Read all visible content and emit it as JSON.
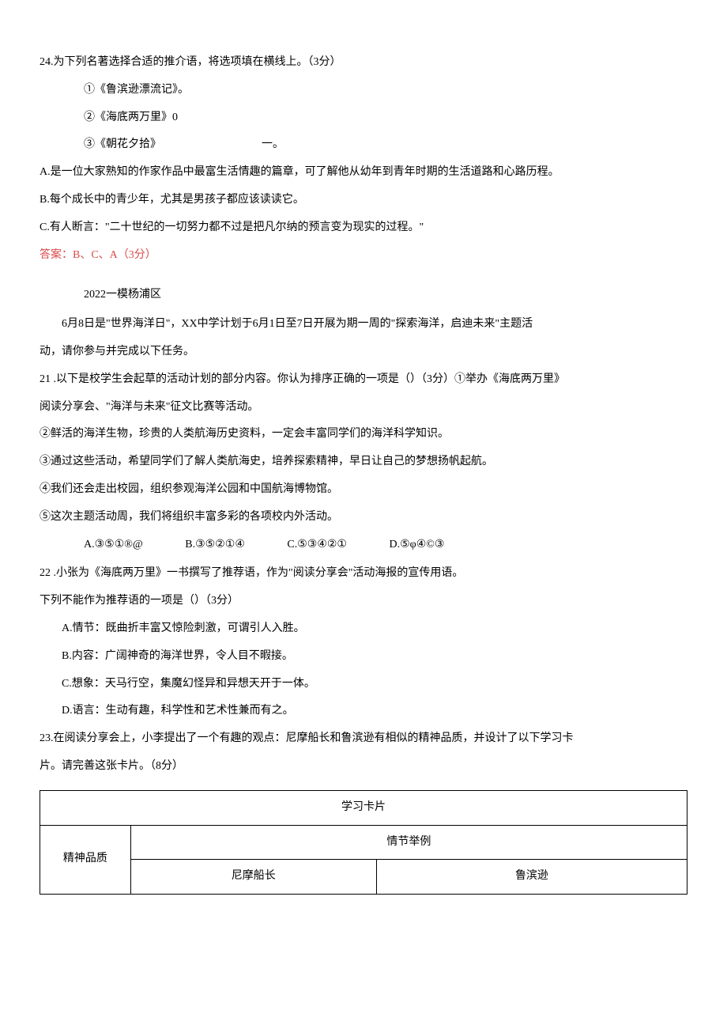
{
  "q24": {
    "stem": "24.为下列名著选择合适的推介语，将选项填在横线上。（3分）",
    "items": [
      "①《鲁滨逊漂流记》。",
      "②《海底两万里》0",
      "③《朝花夕拾》"
    ],
    "item3_tail": "一。",
    "opts": [
      "A.是一位大家熟知的作家作品中最富生活情趣的篇章，可了解他从幼年到青年时期的生活道路和心路历程。",
      "B.每个成长中的青少年，尤其是男孩子都应该读读它。",
      "C.有人断言：\"二十世纪的一切努力都不过是把凡尔纳的预言变为现实的过程。\""
    ],
    "answer": "答案：B、C、A（3分）"
  },
  "section": {
    "title": "2022一模杨浦区",
    "intro1": "6月8日是\"世界海洋日\"，XX中学计划于6月1日至7日开展为期一周的\"探索海洋，启迪未来\"主题活",
    "intro2": "动，请你参与并完成以下任务。"
  },
  "q21": {
    "stem1": "21 .以下是校学生会起草的活动计划的部分内容。你认为排序正确的一项是（）（3分）①举办《海底两万里》",
    "stem2": "阅读分享会、\"海洋与未来\"征文比赛等活动。",
    "seq": [
      "②鲜活的海洋生物，珍贵的人类航海历史资料，一定会丰富同学们的海洋科学知识。",
      "③通过这些活动，希望同学们了解人类航海史，培养探索精神，早日让自己的梦想扬帆起航。",
      "④我们还会走出校园，组织参观海洋公园和中国航海博物馆。",
      "⑤这次主题活动周，我们将组织丰富多彩的各项校内外活动。"
    ],
    "opts": {
      "a": "A.③⑤①®@",
      "b": "B.③⑤②①④",
      "c": "C.⑤③④②①",
      "d": "D.⑤φ④©③"
    }
  },
  "q22": {
    "stem1": "22 .小张为《海底两万里》一书撰写了推荐语，作为\"阅读分享会\"活动海报的宣传用语。",
    "stem2": "下列不能作为推荐语的一项是（）（3分）",
    "opts": [
      "A.情节：既曲折丰富又惊险刺激，可谓引人入胜。",
      "B.内容：广阔神奇的海洋世界，令人目不暇接。",
      "C.想象：天马行空，集魔幻怪异和异想天开于一体。",
      "D.语言：生动有趣，科学性和艺术性兼而有之。"
    ]
  },
  "q23": {
    "stem1": "23.在阅读分享会上，小李提出了一个有趣的观点：尼摩船长和鲁滨逊有相似的精神品质，并设计了以下学习卡",
    "stem2": "片。请完善这张卡片。（8分）"
  },
  "table": {
    "title": "学习卡片",
    "col1": "精神品质",
    "col2_header": "情节举例",
    "col2_a": "尼摩船长",
    "col2_b": "鲁滨逊"
  }
}
